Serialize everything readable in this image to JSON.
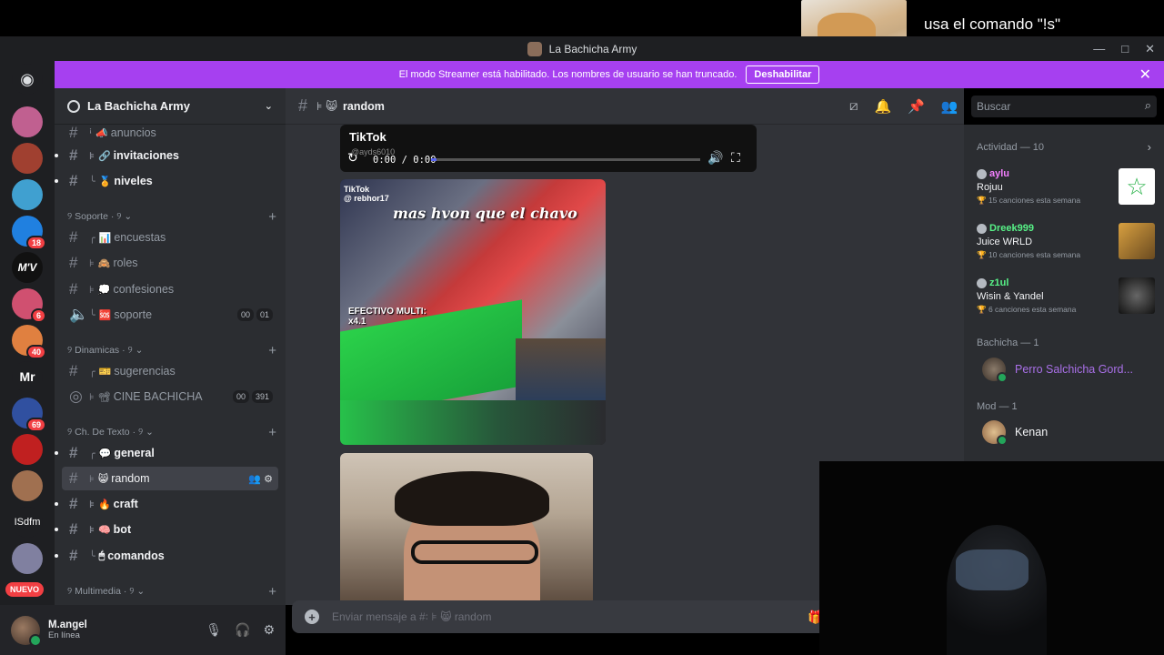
{
  "overlay": {
    "text": "usa el comando \"!s\"\npara que el bot te lea :v"
  },
  "window": {
    "title": "La Bachicha Army",
    "controls": [
      "—",
      "□",
      "✕"
    ]
  },
  "banner": {
    "text": "El modo Streamer está habilitado. Los nombres de usuario se han truncado.",
    "button": "Deshabilitar",
    "close": "✕"
  },
  "guilds": [
    {
      "label": "",
      "color": "#c06090"
    },
    {
      "label": "",
      "color": "#a04030"
    },
    {
      "label": "",
      "color": "#40a0d0"
    },
    {
      "label": "",
      "color": "#2080e0",
      "badge": "18"
    },
    {
      "label": "M'V",
      "color": "#111111"
    },
    {
      "label": "",
      "color": "#d05070",
      "badge": "6"
    },
    {
      "label": "",
      "color": "#e08040",
      "badge": "40"
    },
    {
      "label": "Mr",
      "color": "#1e1f22"
    },
    {
      "label": "",
      "color": "#3050a0",
      "badge": "69"
    },
    {
      "label": "",
      "color": "#c02020"
    },
    {
      "label": "",
      "color": "#a07050"
    },
    {
      "label": "ISdfm",
      "color": "#1e1f22"
    },
    {
      "label": "",
      "color": "#8080a0"
    }
  ],
  "nuevo": "NUEVO",
  "server": {
    "name": "La Bachicha Army",
    "chevron": "⌄"
  },
  "channels": {
    "anuncios": {
      "pfx": "ꜟ",
      "emoji": "📣",
      "name": "anuncios"
    },
    "invitaciones": {
      "pfx": "⊧",
      "emoji": "🔗",
      "name": "invitaciones"
    },
    "niveles": {
      "pfx": "╰",
      "emoji": "🏅",
      "name": "niveles"
    },
    "cat_soporte": "୨ Soporte · ୨ ⌄",
    "encuestas": {
      "pfx": "╭",
      "emoji": "📊",
      "name": "encuestas"
    },
    "roles": {
      "pfx": "⊧",
      "emoji": "🙈",
      "name": "roles"
    },
    "confesiones": {
      "pfx": "⊧",
      "emoji": "💭",
      "name": "confesiones"
    },
    "soporte": {
      "pfx": "╰",
      "emoji": "🆘",
      "name": "soporte",
      "counts": [
        "00",
        "01"
      ]
    },
    "cat_dinamicas": "୨ Dinamicas · ୨ ⌄",
    "sugerencias": {
      "pfx": "╭",
      "emoji": "🎫",
      "name": "sugerencias"
    },
    "cine": {
      "pfx": "⊧",
      "emoji": "📽",
      "name": "CINE BACHICHA",
      "counts": [
        "00",
        "391"
      ]
    },
    "cat_texto": "୨ Ch. De Texto · ୨ ⌄",
    "general": {
      "pfx": "╭",
      "emoji": "💬",
      "name": "general"
    },
    "random": {
      "pfx": "⊧",
      "emoji": "😸",
      "name": "random"
    },
    "craft": {
      "pfx": "⊧",
      "emoji": "🔥",
      "name": "craft"
    },
    "bot": {
      "pfx": "⊧",
      "emoji": "🧠",
      "name": "bot"
    },
    "comandos": {
      "pfx": "╰",
      "emoji": "🖱",
      "name": "comandos"
    },
    "cat_multimedia": "୨ Multimedia · ୨ ⌄"
  },
  "user": {
    "name": "M.angel",
    "status": "En línea"
  },
  "chat": {
    "channel_pfx": "⊧ 😸",
    "channel": "random",
    "search_placeholder": "Buscar",
    "input_placeholder": "Enviar mensaje a #꞉ ⊧ 😸 random"
  },
  "player": {
    "brand": "TikTok",
    "handle": "@ayds6010",
    "time": "0:00 / 0:00"
  },
  "video1": {
    "brand": "TikTok\n@ rebhor17",
    "caption": "mas hvon que el chavo",
    "overlay": "EFECTIVO MULTI:\nx4.1"
  },
  "activity": {
    "title": "Actividad — 10",
    "items": [
      {
        "user": "aylu",
        "song": "Rojuu",
        "meta": "15 canciones esta semana",
        "color": "#f47fff"
      },
      {
        "user": "Dreek999",
        "song": "Juice WRLD",
        "meta": "10 canciones esta semana",
        "color": "#57f287"
      },
      {
        "user": "z1ul",
        "song": "Wisin & Yandel",
        "meta": "6 canciones esta semana",
        "color": "#57f287"
      }
    ]
  },
  "members": {
    "bachicha_title": "Bachicha — 1",
    "bachicha_member": "Perro Salchicha Gord...",
    "mod_title": "Mod — 1",
    "mod_member": "Kenan"
  },
  "colors": {
    "accent": "#a640f0",
    "bachicha_role": "#a970e8",
    "online": "#23a55a"
  }
}
